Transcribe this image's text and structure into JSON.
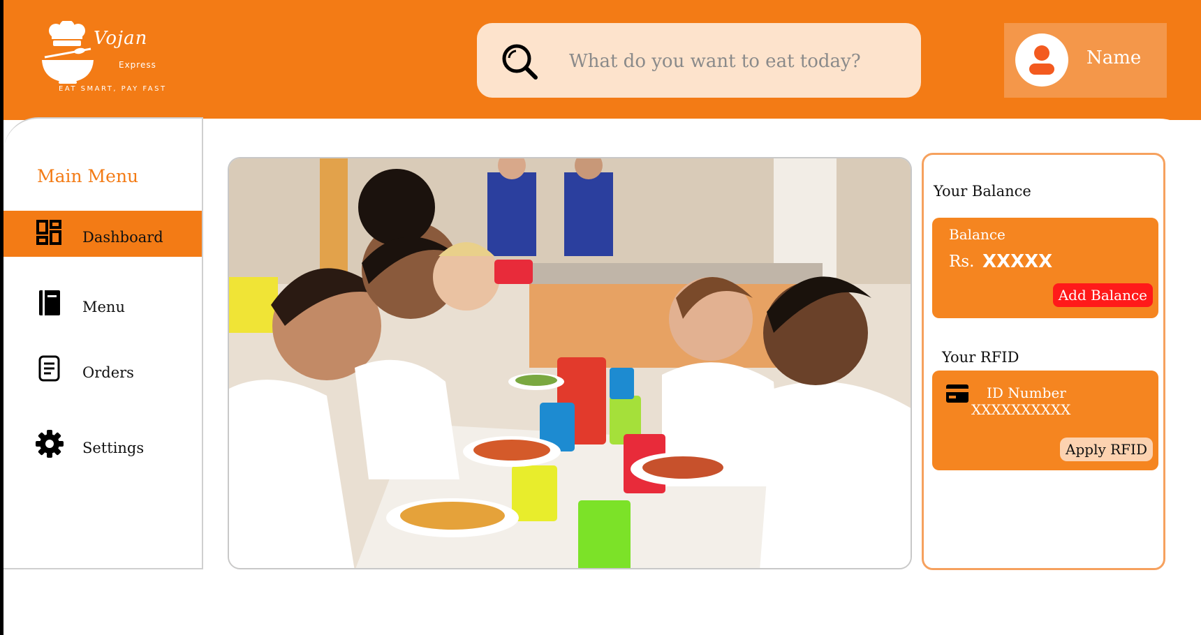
{
  "brand": {
    "name": "Vojan",
    "subname": "Express",
    "tagline": "EAT SMART, PAY FAST"
  },
  "search": {
    "placeholder": "What do you want to eat today?"
  },
  "user": {
    "name": "Name"
  },
  "sidebar": {
    "title": "Main Menu",
    "items": [
      {
        "label": "Dashboard",
        "icon": "dashboard-icon",
        "active": true
      },
      {
        "label": "Menu",
        "icon": "menu-book-icon",
        "active": false
      },
      {
        "label": "Orders",
        "icon": "orders-icon",
        "active": false
      },
      {
        "label": "Settings",
        "icon": "gear-icon",
        "active": false
      }
    ]
  },
  "hero": {
    "image": "children-eating-lunch-photo"
  },
  "wallet": {
    "balance_section": "Your Balance",
    "balance_label": "Balance",
    "currency": "Rs.",
    "amount": "XXXXX",
    "add_button": "Add Balance",
    "rfid_section": "Your RFID",
    "id_label": "ID Number",
    "id_value": "XXXXXXXXXX",
    "apply_button": "Apply RFID"
  },
  "colors": {
    "brand_orange": "#f37b15",
    "card_orange": "#f58520",
    "search_bg": "#fde3cc",
    "add_button_red": "#ff1a1a",
    "apply_button_bg": "#fcd2b0"
  }
}
